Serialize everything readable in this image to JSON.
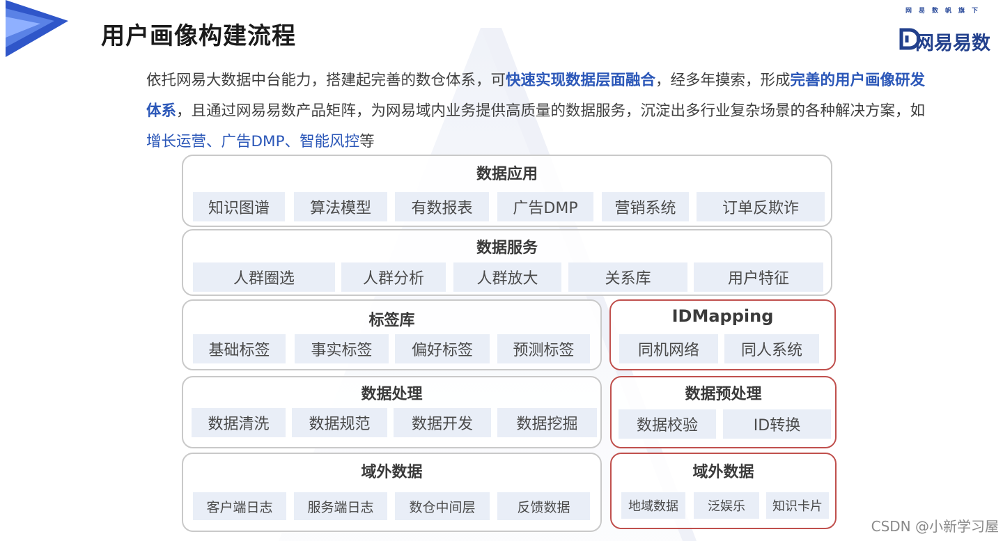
{
  "title": "用户画像构建流程",
  "brand": {
    "slogan": "网易数帆旗下",
    "name": "网易易数"
  },
  "intro": {
    "p1": "依托网易大数据中台能力，搭建起完善的数仓体系，可",
    "hl1": "快速实现数据层面融合",
    "p2": "，经多年摸索，形成",
    "hl2": "完善的用户画像研发体系",
    "p3": "，且通过网易易数产品矩阵，为网易域内业务提供高质量的数据服务，沉淀出多行业复杂场景的各种解决方案，如",
    "hl3": "增长运营、广告DMP、智能风控",
    "p4": "等"
  },
  "layers": {
    "app": {
      "title": "数据应用",
      "items": [
        "知识图谱",
        "算法模型",
        "有数报表",
        "广告DMP",
        "营销系统",
        "订单反欺诈"
      ]
    },
    "service": {
      "title": "数据服务",
      "items": [
        "人群圈选",
        "人群分析",
        "人群放大",
        "关系库",
        "用户特征"
      ]
    },
    "tags": {
      "title": "标签库",
      "items": [
        "基础标签",
        "事实标签",
        "偏好标签",
        "预测标签"
      ]
    },
    "idmapping": {
      "title": "IDMapping",
      "items": [
        "同机网络",
        "同人系统"
      ]
    },
    "process": {
      "title": "数据处理",
      "items": [
        "数据清洗",
        "数据规范",
        "数据开发",
        "数据挖掘"
      ]
    },
    "preprocess": {
      "title": "数据预处理",
      "items": [
        "数据校验",
        "ID转换"
      ]
    },
    "external_left": {
      "title": "域外数据",
      "items": [
        "客户端日志",
        "服务端日志",
        "数仓中间层",
        "反馈数据"
      ]
    },
    "external_right": {
      "title": "域外数据",
      "items": [
        "地域数据",
        "泛娱乐",
        "知识卡片"
      ]
    }
  },
  "watermark": "CSDN @小新学习屋",
  "colors": {
    "accent": "#2b57b8",
    "chip_bg": "#e9eef7",
    "red_border": "#c0504d",
    "gray_border": "#c9c9c9"
  }
}
